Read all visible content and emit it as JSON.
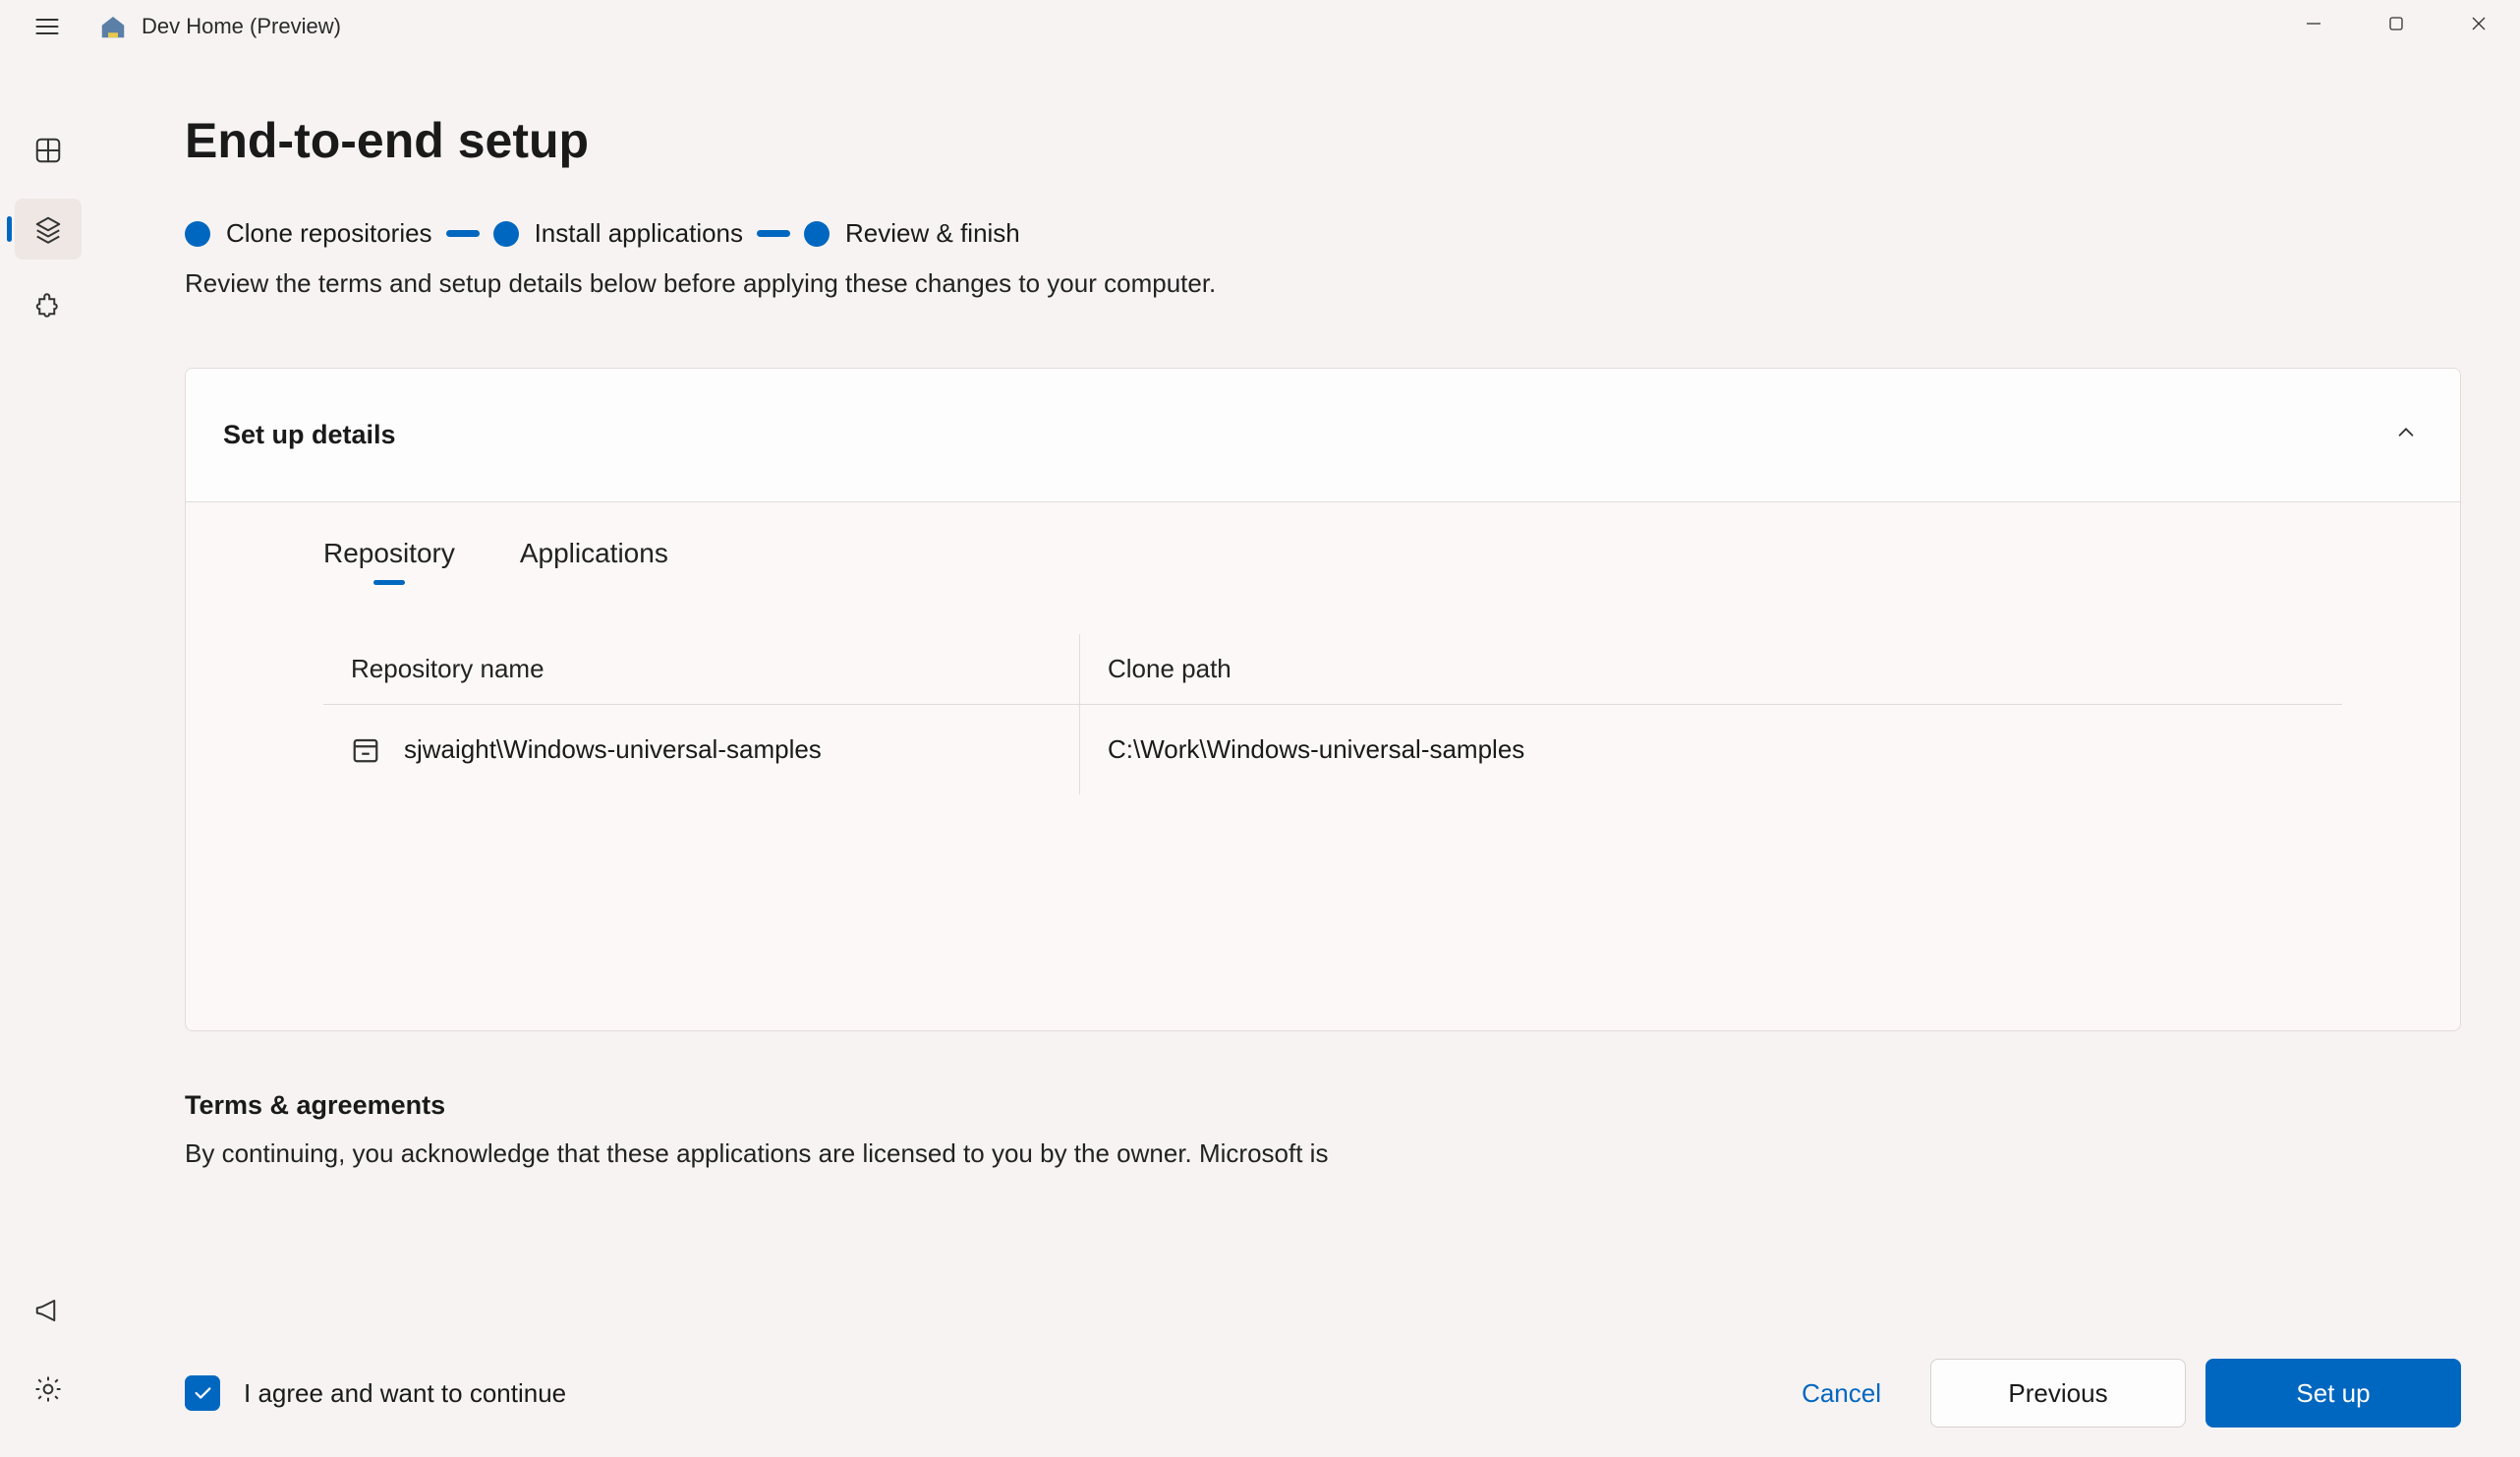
{
  "app": {
    "title": "Dev Home (Preview)"
  },
  "page": {
    "title": "End-to-end setup",
    "subtitle": "Review the terms and setup details below before applying these changes to your computer."
  },
  "steps": [
    "Clone repositories",
    "Install applications",
    "Review & finish"
  ],
  "card": {
    "title": "Set up details",
    "tabs": [
      "Repository",
      "Applications"
    ],
    "table": {
      "headers": [
        "Repository name",
        "Clone path"
      ],
      "rows": [
        {
          "name": "sjwaight\\Windows-universal-samples",
          "path": "C:\\Work\\Windows-universal-samples"
        }
      ]
    }
  },
  "terms": {
    "title": "Terms & agreements",
    "text": "By continuing, you acknowledge that these applications are licensed to you by the owner. Microsoft is"
  },
  "footer": {
    "agree_label": "I agree and want to continue",
    "cancel": "Cancel",
    "previous": "Previous",
    "setup": "Set up"
  }
}
